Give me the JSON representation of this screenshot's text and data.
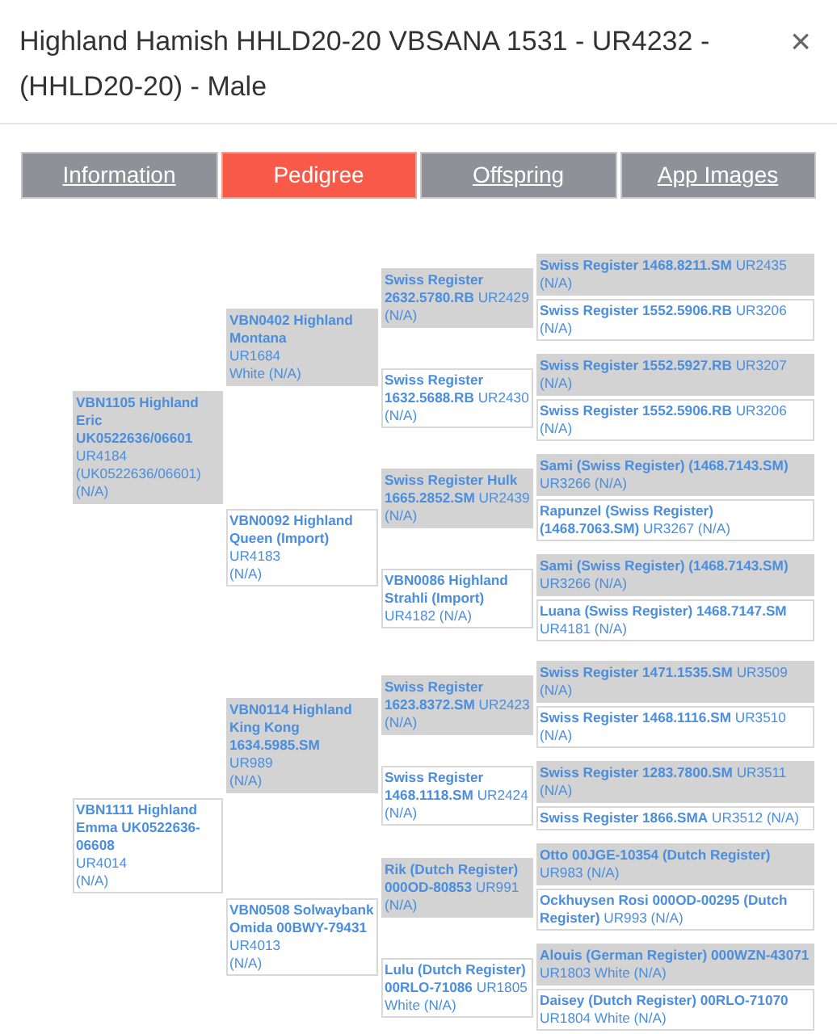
{
  "window": {
    "title": "Highland Hamish HHLD20-20 VBSANA 1531 - UR4232 - (HHLD20-20) - Male",
    "close": "×"
  },
  "tabs": [
    {
      "label": "Information",
      "selected": false
    },
    {
      "label": "Pedigree",
      "selected": true
    },
    {
      "label": "Offspring",
      "selected": false
    },
    {
      "label": "App Images",
      "selected": false
    }
  ],
  "pedigree": [
    {
      "shaded": true,
      "lines": [
        "**VBN1105 Highland Eric UK0522636/06601**",
        "UR4184",
        "(UK0522636/06601)",
        "(N/A)"
      ],
      "children": [
        {
          "shaded": true,
          "lines": [
            "**VBN0402 Highland Montana**",
            "UR1684",
            "White (N/A)"
          ],
          "children": [
            {
              "shaded": true,
              "lines": [
                "**Swiss Register 2632.5780.RB** UR2429 (N/A)"
              ],
              "children": [
                {
                  "shaded": true,
                  "lines": [
                    "**Swiss Register 1468.8211.SM** UR2435 (N/A)"
                  ]
                },
                {
                  "shaded": false,
                  "lines": [
                    "**Swiss Register 1552.5906.RB** UR3206 (N/A)"
                  ]
                }
              ]
            },
            {
              "shaded": false,
              "lines": [
                "**Swiss Register 1632.5688.RB** UR2430 (N/A)"
              ],
              "children": [
                {
                  "shaded": true,
                  "lines": [
                    "**Swiss Register 1552.5927.RB** UR3207 (N/A)"
                  ]
                },
                {
                  "shaded": false,
                  "lines": [
                    "**Swiss Register 1552.5906.RB** UR3206 (N/A)"
                  ]
                }
              ]
            }
          ]
        },
        {
          "shaded": false,
          "lines": [
            "**VBN0092 Highland Queen (Import)**",
            "UR4183",
            "(N/A)"
          ],
          "children": [
            {
              "shaded": true,
              "lines": [
                "**Swiss Register Hulk 1665.2852.SM** UR2439 (N/A)"
              ],
              "children": [
                {
                  "shaded": true,
                  "lines": [
                    "**Sami (Swiss Register) (1468.7143.SM)** UR3266 (N/A)"
                  ]
                },
                {
                  "shaded": false,
                  "lines": [
                    "**Rapunzel (Swiss Register) (1468.7063.SM)** UR3267 (N/A)"
                  ]
                }
              ]
            },
            {
              "shaded": false,
              "lines": [
                "**VBN0086 Highland Strahli (Import)** UR4182 (N/A)"
              ],
              "children": [
                {
                  "shaded": true,
                  "lines": [
                    "**Sami (Swiss Register) (1468.7143.SM)** UR3266 (N/A)"
                  ]
                },
                {
                  "shaded": false,
                  "lines": [
                    "**Luana (Swiss Register) 1468.7147.SM** UR4181 (N/A)"
                  ]
                }
              ]
            }
          ]
        }
      ]
    },
    {
      "shaded": false,
      "lines": [
        "**VBN1111 Highland Emma UK0522636-06608**",
        "UR4014",
        "(N/A)"
      ],
      "children": [
        {
          "shaded": true,
          "lines": [
            "**VBN0114 Highland King Kong 1634.5985.SM**",
            "UR989",
            "(N/A)"
          ],
          "children": [
            {
              "shaded": true,
              "lines": [
                "**Swiss Register 1623.8372.SM** UR2423 (N/A)"
              ],
              "children": [
                {
                  "shaded": true,
                  "lines": [
                    "**Swiss Register 1471.1535.SM** UR3509 (N/A)"
                  ]
                },
                {
                  "shaded": false,
                  "lines": [
                    "**Swiss Register 1468.1116.SM** UR3510 (N/A)"
                  ]
                }
              ]
            },
            {
              "shaded": false,
              "lines": [
                "**Swiss Register 1468.1118.SM** UR2424 (N/A)"
              ],
              "children": [
                {
                  "shaded": true,
                  "lines": [
                    "**Swiss Register 1283.7800.SM** UR3511 (N/A)"
                  ]
                },
                {
                  "shaded": false,
                  "lines": [
                    "**Swiss Register 1866.SMA** UR3512 (N/A)"
                  ]
                }
              ]
            }
          ]
        },
        {
          "shaded": false,
          "lines": [
            "**VBN0508 Solwaybank Omida 00BWY-79431**",
            "UR4013",
            "(N/A)"
          ],
          "children": [
            {
              "shaded": true,
              "lines": [
                "**Rik (Dutch Register) 000OD-80853** UR991 (N/A)"
              ],
              "children": [
                {
                  "shaded": true,
                  "lines": [
                    "**Otto 00JGE-10354 (Dutch Register)** UR983 (N/A)"
                  ]
                },
                {
                  "shaded": false,
                  "lines": [
                    "**Ockhuysen Rosi 000OD-00295 (Dutch Register)** UR993 (N/A)"
                  ]
                }
              ]
            },
            {
              "shaded": false,
              "lines": [
                "**Lulu (Dutch Register) 00RLO-71086** UR1805 White (N/A)"
              ],
              "children": [
                {
                  "shaded": true,
                  "lines": [
                    "**Alouis (German Register) 000WZN-43071** UR1803 White (N/A)"
                  ]
                },
                {
                  "shaded": false,
                  "lines": [
                    "**Daisey (Dutch Register) 00RLO-71070** UR1804 White (N/A)"
                  ]
                }
              ]
            }
          ]
        }
      ]
    }
  ]
}
